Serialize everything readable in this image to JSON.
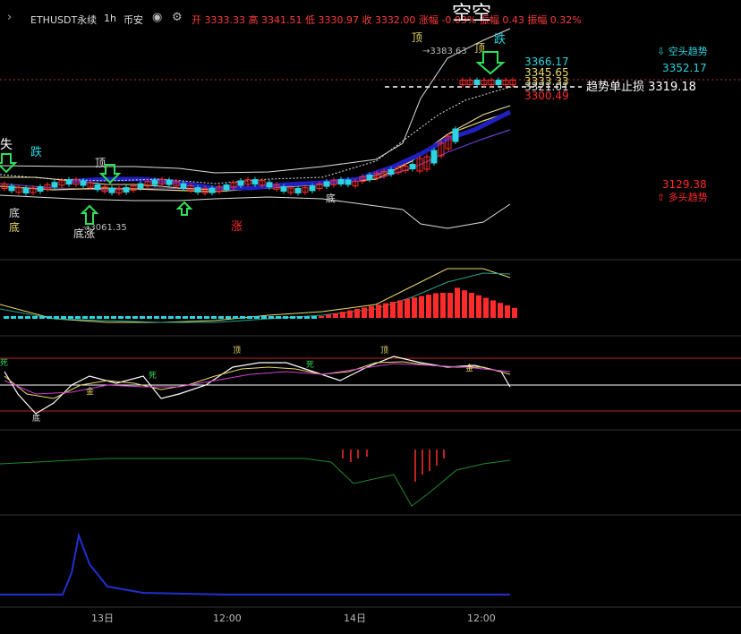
{
  "header": {
    "chevron": "›",
    "symbol": "ETHUSDT永续",
    "interval": "1h",
    "exchange": "币安",
    "eye_icon": "eye-icon",
    "gear_icon": "gear-icon",
    "ohlc": "开 3333.33 高 3341.51 低 3330.97 收 3332.00 涨幅 -0.03% 振幅 0.43 振幅 0.32%"
  },
  "colors": {
    "up": "#ff2a2a",
    "down": "#2ad4e0",
    "bg": "#000000",
    "grid": "#333333"
  },
  "main_pane": {
    "labels": {
      "kong_top": "空空",
      "die_top": "跌",
      "ding_left": "顶",
      "ding_right": "顶",
      "high_marker": "→3383.63",
      "die_left": "跌",
      "ding_mid": "顶",
      "di_left1": "底",
      "di_left2": "底",
      "di_mid": "底",
      "zhang": "涨",
      "low_marker": "→3061.35",
      "di_zhang": "底涨",
      "cut_left": "失",
      "stop_loss": "趋势单止损 3319.18"
    },
    "price_tags": [
      "3366.17",
      "3345.65",
      "3333.33",
      "3321.01",
      "3300.49"
    ],
    "right_panel": {
      "bear_trend": "⇩ 空头趋势",
      "bear_value": "3352.17",
      "bull_value": "3129.38",
      "bull_trend": "⇧ 多头趋势"
    }
  },
  "kdj_pane": {
    "labels": [
      "顶",
      "顶",
      "死",
      "死",
      "死",
      "金",
      "金",
      "底"
    ]
  },
  "x_axis": [
    "13日",
    "12:00",
    "14日",
    "12:00"
  ]
}
